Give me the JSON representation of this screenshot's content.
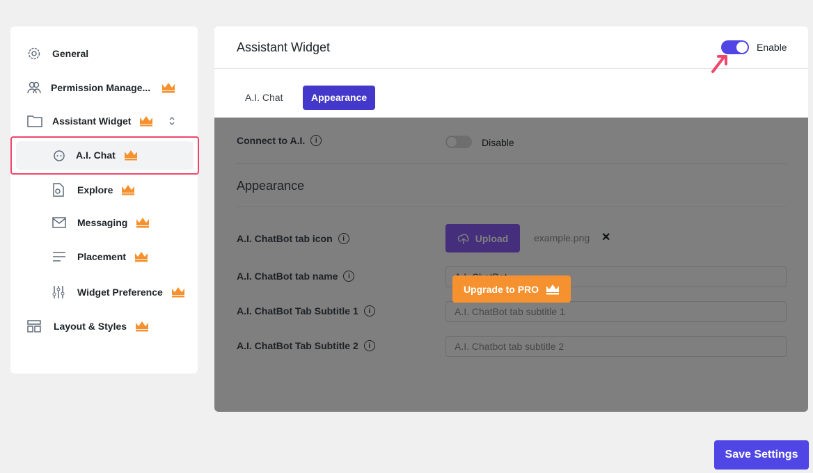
{
  "sidebar": {
    "items": [
      {
        "label": "General",
        "icon": "gear-icon"
      },
      {
        "label": "Permission Manage...",
        "icon": "users-icon",
        "pro": true
      },
      {
        "label": "Assistant Widget",
        "icon": "folder-icon",
        "pro": true
      },
      {
        "label": "A.I. Chat",
        "icon": "bot-icon",
        "pro": true,
        "selected": true
      },
      {
        "label": "Explore",
        "icon": "search-doc-icon",
        "pro": true
      },
      {
        "label": "Messaging",
        "icon": "mail-icon",
        "pro": true
      },
      {
        "label": "Placement",
        "icon": "lines-icon",
        "pro": true
      },
      {
        "label": "Widget Preference",
        "icon": "sliders-icon",
        "pro": true
      },
      {
        "label": "Layout & Styles",
        "icon": "layout-icon",
        "pro": true
      }
    ]
  },
  "header": {
    "title": "Assistant Widget",
    "toggle_label": "Enable",
    "enabled": true
  },
  "tabs": [
    {
      "label": "A.I. Chat"
    },
    {
      "label": "Appearance",
      "active": true
    }
  ],
  "content": {
    "connect_label": "Connect to A.I.",
    "connect_toggle_label": "Disable",
    "section_title": "Appearance",
    "tab_icon_label": "A.I. ChatBot tab icon",
    "upload_label": "Upload",
    "file_name": "example.png",
    "tab_name_label": "A.I. ChatBot tab name",
    "tab_name_value": "A.I. ChatBot",
    "subtitle1_label": "A.I. ChatBot Tab Subtitle 1",
    "subtitle1_placeholder": "A.I. ChatBot tab subtitle 1",
    "subtitle2_label": "A.I. ChatBot Tab Subtitle 2",
    "subtitle2_placeholder": "A.I. Chatbot tab subtitle 2"
  },
  "upgrade_label": "Upgrade to PRO",
  "save_label": "Save Settings",
  "colors": {
    "accent": "#4f46e5",
    "pro": "#f5922f",
    "highlight": "#f0466b"
  }
}
